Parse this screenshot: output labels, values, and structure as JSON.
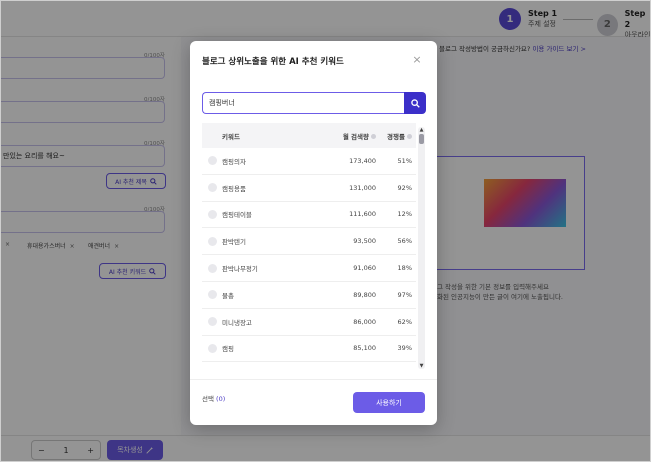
{
  "steps": [
    {
      "number": "1",
      "title": "Step 1",
      "subtitle": "주제 설정",
      "color": "#5a4ad8"
    },
    {
      "number": "2",
      "title": "Step 2",
      "subtitle": "아웃라인",
      "color": "#bdbdc6"
    }
  ],
  "left_form": {
    "counters": [
      "0/100자",
      "0/100자",
      "0/100자",
      "0/100자"
    ],
    "topic_text": "만있는 요리를 해요~",
    "ai_title_button": "AI 추천 제목",
    "tags": [
      "휴대용가스버너",
      "애견버너"
    ],
    "ai_keyword_button": "AI 추천 키워드"
  },
  "right_panel": {
    "guide_question": "인 블로그 작성방법이 궁금하신가요?",
    "guide_link": "이용 가이드 보기 >",
    "desc_line1": "로그 작성을 위한 기본 정보를 입력해주세요",
    "desc_line2": "악화된 인공지능이 만든 글이 여기에 노출됩니다."
  },
  "bottom_bar": {
    "stepper_minus": "−",
    "stepper_value": "1",
    "stepper_plus": "+",
    "generate_button": "목차생성"
  },
  "modal": {
    "title": "블로그 상위노출을 위한 AI 추천 키워드",
    "close_glyph": "×",
    "search_value": "캠핑버너",
    "table_headers": {
      "keyword": "키워드",
      "volume": "월 검색량",
      "competition": "경쟁률"
    },
    "rows": [
      {
        "keyword": "캠핑의자",
        "volume": "173,400",
        "competition": "51%"
      },
      {
        "keyword": "캠핑용품",
        "volume": "131,000",
        "competition": "92%"
      },
      {
        "keyword": "캠핑테이블",
        "volume": "111,600",
        "competition": "12%"
      },
      {
        "keyword": "판박텐기",
        "volume": "93,500",
        "competition": "56%"
      },
      {
        "keyword": "판박나무정기",
        "volume": "91,060",
        "competition": "18%"
      },
      {
        "keyword": "물총",
        "volume": "89,800",
        "competition": "97%"
      },
      {
        "keyword": "미니냉장고",
        "volume": "86,000",
        "competition": "62%"
      },
      {
        "keyword": "캠핑",
        "volume": "85,100",
        "competition": "39%"
      }
    ],
    "selection_label": "선택",
    "selection_count": "(0)",
    "use_button": "사용하기"
  },
  "colors": {
    "accent": "#6c5ce7",
    "accent_dark": "#3b2fc9"
  }
}
